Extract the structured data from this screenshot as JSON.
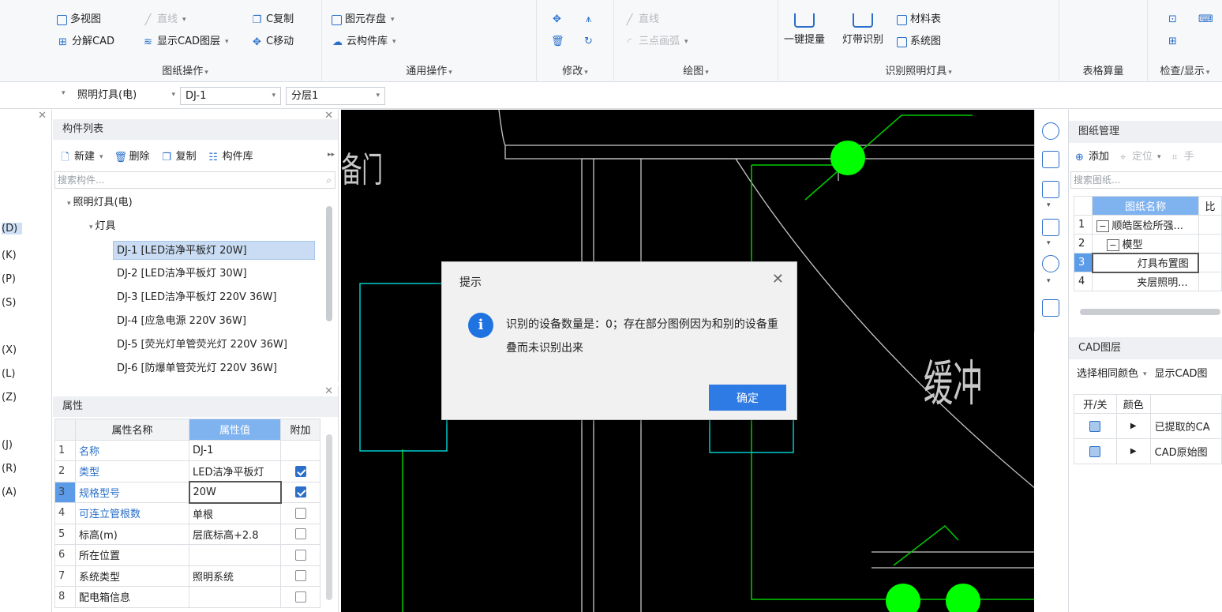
{
  "ribbon": {
    "drawing_ops": {
      "title": "图纸操作",
      "multi_view": "多视图",
      "explode_cad": "分解CAD",
      "line": "直线",
      "show_cad_layer": "显示CAD图层",
      "c_copy": "C复制",
      "c_move": "C移动"
    },
    "general_ops": {
      "title": "通用操作",
      "element_save": "图元存盘",
      "cloud_lib": "云构件库"
    },
    "modify": {
      "title": "修改"
    },
    "draw": {
      "title": "绘图",
      "line": "直线",
      "three_point_arc": "三点画弧"
    },
    "identify": {
      "title": "识别照明灯具",
      "one_click": "一键提量",
      "strip_light": "灯带识别",
      "material_table": "材料表",
      "system_diagram": "系统图"
    },
    "table_calc": {
      "title": "表格算量"
    },
    "check_display": {
      "title": "检查/显示"
    }
  },
  "filterbar": {
    "category": "照明灯具(电)",
    "component": "DJ-1",
    "layer": "分层1"
  },
  "leftstrip": {
    "items": [
      "(D)",
      "(K)",
      "(P)",
      "(S)",
      "(X)",
      "(L)",
      "(Z)",
      "(J)",
      "(R)",
      "(A)"
    ]
  },
  "complist": {
    "title": "构件列表",
    "new": "新建",
    "delete": "删除",
    "copy": "复制",
    "library": "构件库",
    "search_placeholder": "搜索构件...",
    "root": "照明灯具(电)",
    "group": "灯具",
    "items": [
      "DJ-1 [LED洁净平板灯 20W]",
      "DJ-2 [LED洁净平板灯 30W]",
      "DJ-3 [LED洁净平板灯 220V 36W]",
      "DJ-4 [应急电源 220V 36W]",
      "DJ-5 [荧光灯单管荧光灯 220V 36W]",
      "DJ-6 [防爆单管荧光灯 220V 36W]"
    ]
  },
  "props": {
    "title": "属性",
    "headers": [
      "属性名称",
      "属性值",
      "附加"
    ],
    "rows": [
      {
        "idx": "1",
        "name": "名称",
        "value": "DJ-1",
        "checked": null
      },
      {
        "idx": "2",
        "name": "类型",
        "value": "LED洁净平板灯",
        "checked": true
      },
      {
        "idx": "3",
        "name": "规格型号",
        "value": "20W",
        "checked": true
      },
      {
        "idx": "4",
        "name": "可连立管根数",
        "value": "单根",
        "checked": false
      },
      {
        "idx": "5",
        "name": "标高(m)",
        "value": "层底标高+2.8",
        "checked": false
      },
      {
        "idx": "6",
        "name": "所在位置",
        "value": "",
        "checked": false
      },
      {
        "idx": "7",
        "name": "系统类型",
        "value": "照明系统",
        "checked": false
      },
      {
        "idx": "8",
        "name": "配电箱信息",
        "value": "",
        "checked": false
      }
    ]
  },
  "canvas": {
    "text_door": "备门",
    "text_buffer": "缓冲"
  },
  "drawings": {
    "title": "图纸管理",
    "add": "添加",
    "locate": "定位",
    "manual": "手",
    "search_placeholder": "搜索图纸...",
    "col_name": "图纸名称",
    "col_ratio": "比",
    "rows": [
      {
        "idx": "1",
        "name": "顺皓医检所强..."
      },
      {
        "idx": "2",
        "name": "模型"
      },
      {
        "idx": "3",
        "name": "灯具布置图"
      },
      {
        "idx": "4",
        "name": "夹层照明..."
      }
    ]
  },
  "cad_layers": {
    "title": "CAD图层",
    "select_same_color": "选择相同颜色",
    "show_cad": "显示CAD图",
    "col_toggle": "开/关",
    "col_color": "颜色",
    "rows": [
      "已提取的CA",
      "CAD原始图"
    ]
  },
  "dialog": {
    "title": "提示",
    "message": "识别的设备数量是：0；存在部分图例因为和别的设备重叠而未识别出来",
    "ok": "确定"
  }
}
